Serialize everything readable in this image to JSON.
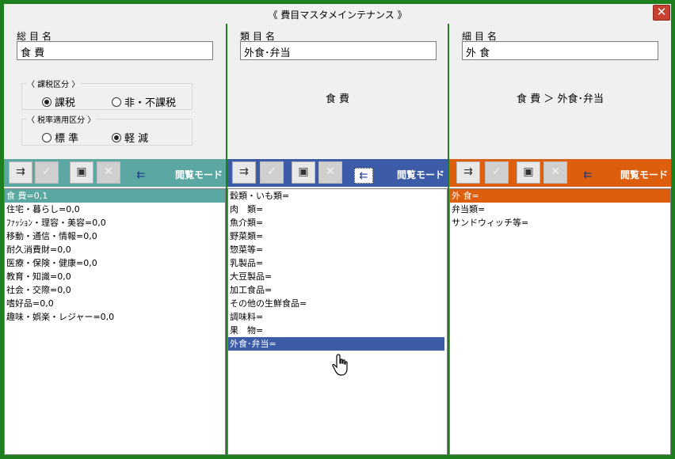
{
  "window": {
    "title": "《 費目マスタメインテナンス 》",
    "close_glyph": "✕"
  },
  "colors": {
    "green_frame": "#1e7f1e",
    "teal": "#5ba8a3",
    "blue": "#3d5ca8",
    "orange": "#dd5e0c"
  },
  "col1": {
    "label": "総目名",
    "value": "食 費",
    "tax_group": {
      "title": "〈 課税区分 〉",
      "options": [
        "課税",
        "非・不課税"
      ],
      "selected": "課税"
    },
    "rate_group": {
      "title": "〈 税率適用区分 〉",
      "options": [
        "標 準",
        "軽 減"
      ],
      "selected": "軽 減"
    },
    "mode": "閲覧モード",
    "items": [
      "食 費=0,1",
      "住宅・暮らし=0,0",
      "ﾌｧｯｼｮﾝ・理容・美容=0,0",
      "移動・通信・情報=0,0",
      "耐久消費財=0,0",
      "医療・保険・健康=0,0",
      "教育・知識=0,0",
      "社会・交際=0,0",
      "嗜好品=0,0",
      "趣味・娯楽・レジャー=0,0"
    ],
    "selected_index": 0
  },
  "col2": {
    "label": "類目名",
    "value": "外食･弁当",
    "breadcrumb": "食 費",
    "mode": "閲覧モード",
    "items": [
      "穀類・いも類=",
      "肉　類=",
      "魚介類=",
      "野菜類=",
      "惣菜等=",
      "乳製品=",
      "大豆製品=",
      "加工食品=",
      "その他の生鮮食品=",
      "調味料=",
      "果　物=",
      "外食･弁当="
    ],
    "selected_index": 11
  },
  "col3": {
    "label": "細目名",
    "value": "外 食",
    "breadcrumb": "食 費 ＞ 外食･弁当",
    "mode": "閲覧モード",
    "items": [
      "外 食=",
      "弁当類=",
      "サンドウィッチ等="
    ],
    "selected_index": 0
  },
  "toolbar_icons": [
    "add-row-icon",
    "check-icon",
    "document-copy-icon",
    "delete-icon",
    "move-row-icon"
  ]
}
